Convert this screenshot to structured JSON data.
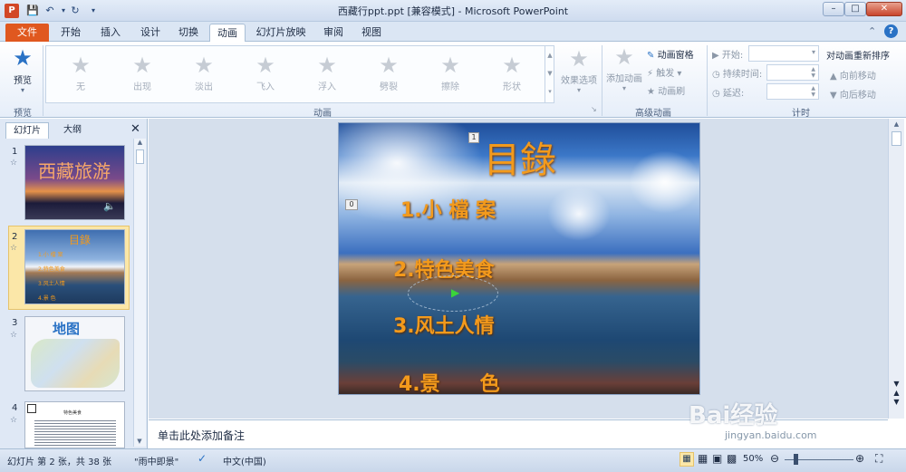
{
  "window": {
    "title": "西藏行ppt.ppt [兼容模式] - Microsoft PowerPoint"
  },
  "tabs": [
    {
      "label": "文件"
    },
    {
      "label": "开始"
    },
    {
      "label": "插入"
    },
    {
      "label": "设计"
    },
    {
      "label": "切换"
    },
    {
      "label": "动画"
    },
    {
      "label": "幻灯片放映"
    },
    {
      "label": "审阅"
    },
    {
      "label": "视图"
    }
  ],
  "ribbon": {
    "preview": {
      "label": "预览",
      "group": "预览"
    },
    "animations": [
      {
        "label": "无"
      },
      {
        "label": "出现"
      },
      {
        "label": "淡出"
      },
      {
        "label": "飞入"
      },
      {
        "label": "浮入"
      },
      {
        "label": "劈裂"
      },
      {
        "label": "擦除"
      },
      {
        "label": "形状"
      }
    ],
    "effect_options": "效果选项",
    "animation_group": "动画",
    "add_animation": "添加动画",
    "animation_pane": "动画窗格",
    "trigger": "触发",
    "animation_painter": "动画刷",
    "advanced_group": "高级动画",
    "start_label": "开始:",
    "duration_label": "持续时间:",
    "delay_label": "延迟:",
    "timing_group": "计时",
    "reorder_title": "对动画重新排序",
    "move_earlier": "向前移动",
    "move_later": "向后移动"
  },
  "left_pane": {
    "tabs": [
      {
        "label": "幻灯片"
      },
      {
        "label": "大纲"
      }
    ],
    "slides": [
      {
        "num": "1",
        "title": "西藏旅游"
      },
      {
        "num": "2",
        "title": "目錄"
      },
      {
        "num": "3",
        "title": "地图"
      },
      {
        "num": "4",
        "title": "特色美食"
      }
    ],
    "thumb2_items": [
      "1.小 檔 案",
      "2.特色美食",
      "3.风土人情",
      "4.景  色"
    ]
  },
  "slide": {
    "title": "目錄",
    "items": [
      "1.小 檔 案",
      "2.特色美食",
      "3.风土人情",
      "4.景　　色"
    ],
    "tag_1": "1",
    "tag_0": "0"
  },
  "notes": {
    "placeholder": "单击此处添加备注"
  },
  "status": {
    "slide_info": "幻灯片 第 2 张，共 38 张",
    "theme": "\"雨中即景\"",
    "language": "中文(中国)",
    "zoom": "50%"
  },
  "watermark": {
    "brand": "Bai经验",
    "url": "jingyan.baidu.com"
  },
  "colors": {
    "file_tab": "#e0581f",
    "accent": "#2a72c5",
    "slide_text": "#f39a1c"
  }
}
